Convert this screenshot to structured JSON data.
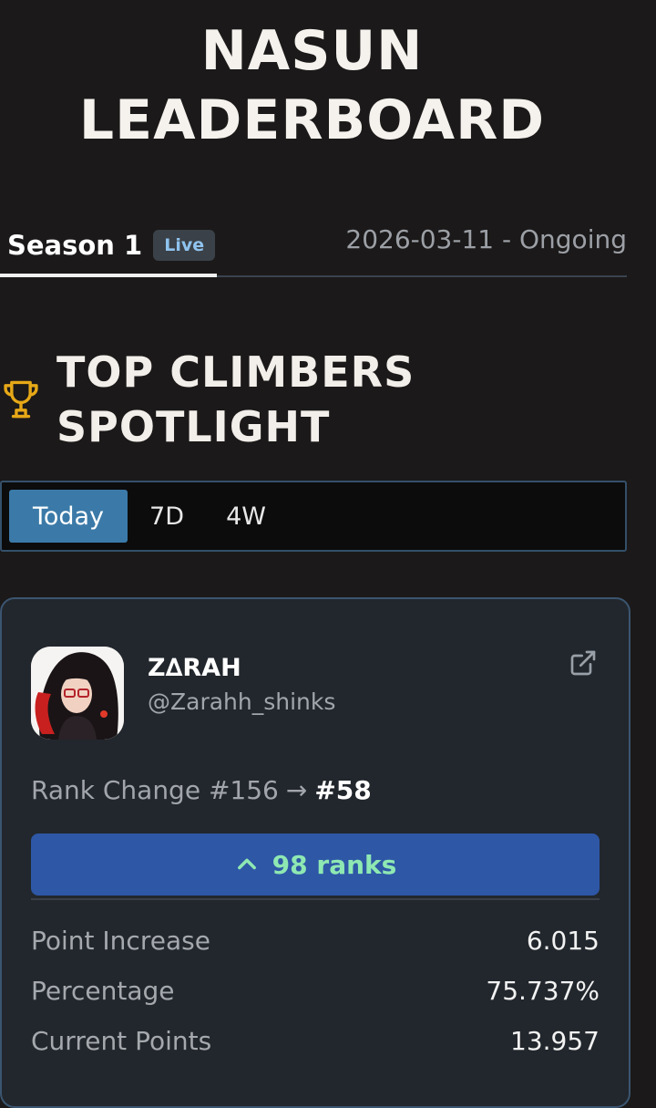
{
  "header": {
    "title_line1": "NASUN",
    "title_line2": "LEADERBOARD"
  },
  "season": {
    "name": "Season 1",
    "badge": "Live",
    "dates": "2026-03-11 - Ongoing"
  },
  "spotlight": {
    "title_line1": "TOP CLIMBERS",
    "title_line2": "SPOTLIGHT",
    "icon": "trophy-icon",
    "icon_color": "#e6a817"
  },
  "range_tabs": [
    {
      "label": "Today",
      "active": true
    },
    {
      "label": "7D",
      "active": false
    },
    {
      "label": "4W",
      "active": false
    }
  ],
  "card": {
    "name": "Z∆RAH",
    "handle": "@Zarahh_shinks",
    "rank_change_label": "Rank Change #156",
    "rank_arrow": "→",
    "new_rank": "#58",
    "ranks_gained": "98 ranks",
    "stats": [
      {
        "label": "Point Increase",
        "value": "6.015"
      },
      {
        "label": "Percentage",
        "value": "75.737%"
      },
      {
        "label": "Current Points",
        "value": "13.957"
      }
    ]
  },
  "colors": {
    "background": "#1b1919",
    "accent_blue": "#3b7aa8",
    "ranks_bar": "#2e57a6",
    "ranks_text": "#8ee8b2"
  }
}
